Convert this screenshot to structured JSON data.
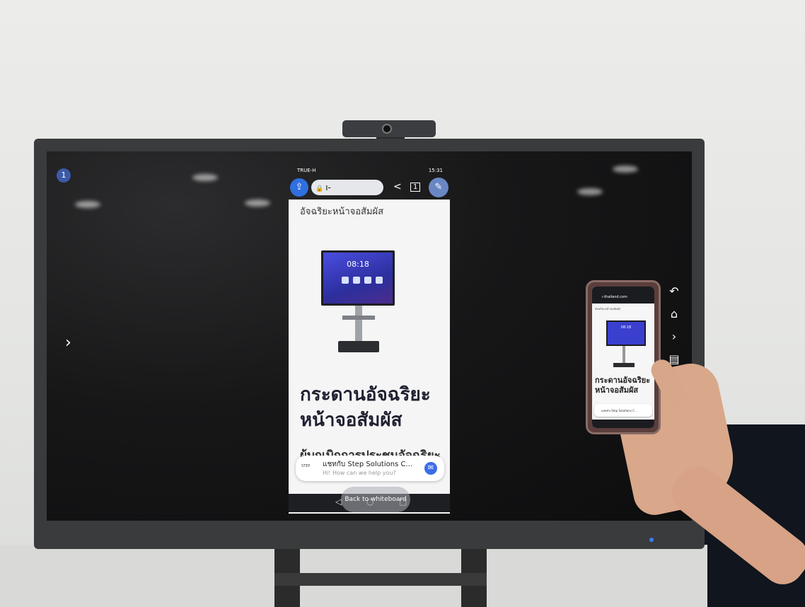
{
  "screen": {
    "page_badge": "1",
    "left_arrow": "›",
    "side_tools": [
      {
        "icon": "undo-arrow-icon",
        "glyph": "↶"
      },
      {
        "icon": "home-icon",
        "glyph": "⌂"
      },
      {
        "icon": "chevron-right-icon",
        "glyph": "›"
      },
      {
        "icon": "toolbox-icon",
        "glyph": "▤"
      }
    ]
  },
  "mirror": {
    "status_left": "TRUE-H",
    "status_right": "15:31",
    "url": "ı-thailand.com",
    "tab_count": "1",
    "page_heading": "อัจฉริยะหน้าจอสัมผัส",
    "product_clock": "08:18",
    "title_line1": "กระดานอัจฉริยะ",
    "title_line2": "หน้าจอสัมผัส",
    "cut_text": "ผู้บุกเบิกการประชุมอัจฉริยะ",
    "chat_title": "แชทกับ Step Solutions C...",
    "chat_subtitle": "Hi! How can we help you?",
    "back_to_whiteboard": "Back to whiteboard"
  },
  "handset": {
    "url": "ı-thailand.com",
    "clock": "08:18",
    "title_line1": "กระดานอัจฉริยะ",
    "title_line2": "หน้าจอสัมผัส",
    "chat_text": "แชทกับ Step Solutions C..."
  }
}
